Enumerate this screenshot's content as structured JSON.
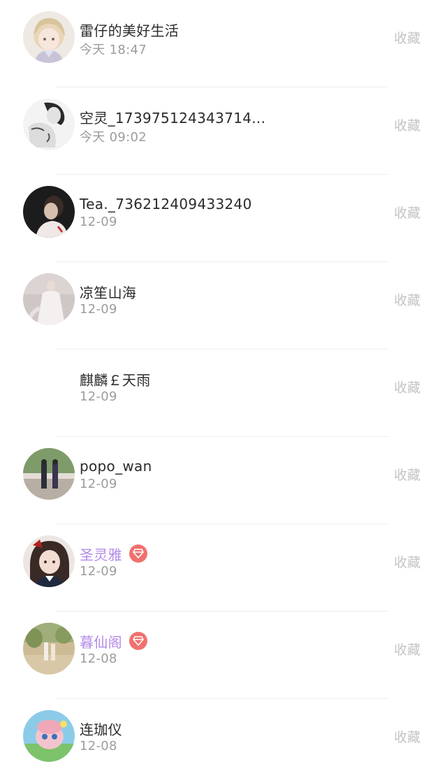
{
  "collect_label": "收藏",
  "colors": {
    "vip_name": "#b48be8",
    "vip_badge": "#f0716f",
    "collect_text": "#c4c4c4",
    "time_text": "#9c9c9c",
    "divider": "#efefef"
  },
  "rows": [
    {
      "name": "雷仔的美好生活",
      "time": "今天 18:47",
      "vip": false,
      "avatar": "anime-girl-avatar"
    },
    {
      "name": "空灵_173975124343714...",
      "time": "今天 09:02",
      "vip": false,
      "avatar": "bw-photo-avatar"
    },
    {
      "name": "Tea._736212409433240",
      "time": "12-09",
      "vip": false,
      "avatar": "dark-portrait-avatar"
    },
    {
      "name": "凉笙山海",
      "time": "12-09",
      "vip": false,
      "avatar": "white-dress-avatar"
    },
    {
      "name": "麒麟￡天雨",
      "time": "12-09",
      "vip": false,
      "avatar": "blank-avatar"
    },
    {
      "name": "popo_wan",
      "time": "12-09",
      "vip": false,
      "avatar": "dancers-avatar"
    },
    {
      "name": "圣灵雅",
      "time": "12-09",
      "vip": true,
      "avatar": "girl-bow-avatar"
    },
    {
      "name": "暮仙阁",
      "time": "12-08",
      "vip": true,
      "avatar": "outdoor-avatar"
    },
    {
      "name": "连珈仪",
      "time": "12-08",
      "vip": false,
      "avatar": "cartoon-avatar"
    }
  ]
}
